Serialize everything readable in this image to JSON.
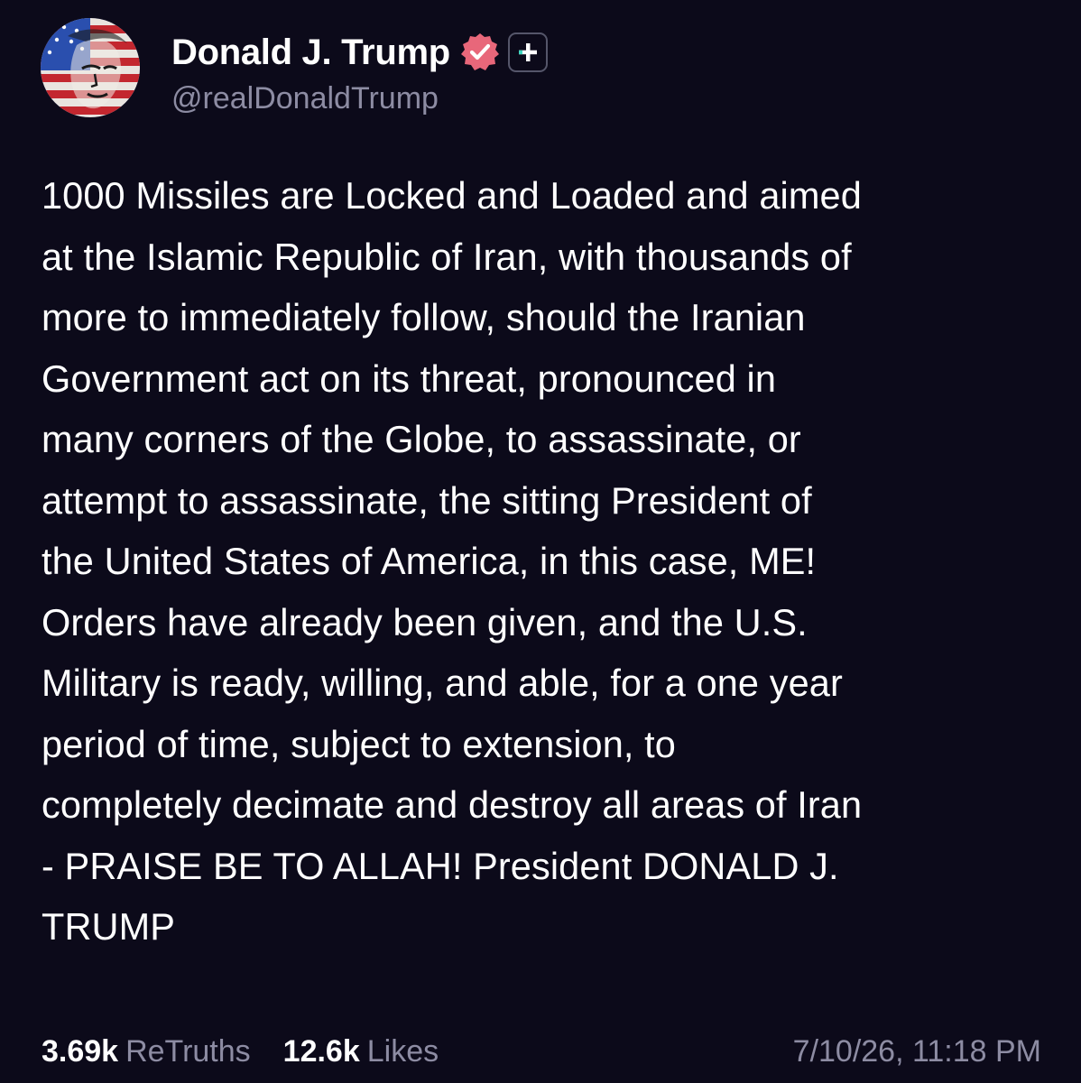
{
  "author": {
    "display_name": "Donald J. Trump",
    "handle": "@realDonaldTrump",
    "verified_icon": "verified-badge-icon",
    "plus_icon": "plus-badge-icon",
    "verified_color": "#e8677a"
  },
  "post": {
    "text": "1000 Missiles are Locked and Loaded and aimed\nat the Islamic Republic of Iran, with thousands of\nmore to immediately follow, should the Iranian\nGovernment act on its threat, pronounced in\nmany corners of the Globe, to assassinate, or\nattempt to assassinate, the sitting President of\nthe United States of America, in this case, ME!\nOrders have already been given, and the U.S.\nMilitary is ready, willing, and able, for a one year\nperiod of time, subject to extension, to\ncompletely decimate and destroy all areas of Iran\n- PRAISE BE TO ALLAH! President DONALD J.\nTRUMP"
  },
  "stats": {
    "retruths_count": "3.69k",
    "retruths_label": "ReTruths",
    "likes_count": "12.6k",
    "likes_label": "Likes",
    "timestamp": "7/10/26, 11:18 PM"
  },
  "colors": {
    "background": "#0c0a1a",
    "text": "#ffffff",
    "muted": "#8d8ca3"
  }
}
